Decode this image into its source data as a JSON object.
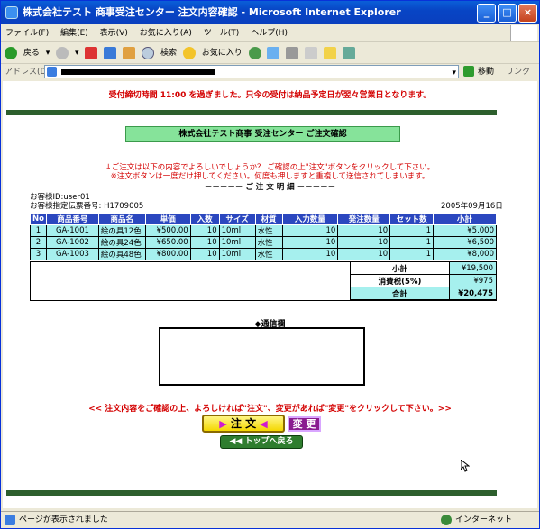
{
  "window": {
    "title": "株式会社テスト 商事受注センター  注文内容確認 - Microsoft Internet Explorer",
    "min": "_",
    "max": "□",
    "close": "×"
  },
  "menu": [
    "ファイル(F)",
    "編集(E)",
    "表示(V)",
    "お気に入り(A)",
    "ツール(T)",
    "ヘルプ(H)"
  ],
  "toolbar": {
    "back": "戻る",
    "search": "検索",
    "favorites": "お気に入り"
  },
  "address": {
    "label": "アドレス(D)",
    "go": "移動",
    "links": "リンク"
  },
  "page": {
    "notice": "受付締切時間 11:00 を過ぎました。只今の受付は納品予定日が翌々営業日となります。",
    "header_title": "株式会社テスト商事 受注センター  ご注文確認",
    "confirm_line1": "↓ご注文は以下の内容でよろしいでしょうか？  ご確認の上\"注文\"ボタンをクリックして下さい。",
    "confirm_line2": "※注文ボタンは一度だけ押してください。何度も押しますと重複して送信されてしまいます。",
    "meisai": "－－－－－ ご 注 文 明 細 －－－－－",
    "customer_id": "お客様ID:user01",
    "slip_no": "お客様指定伝票番号: H1709005",
    "date": "2005年09月16日",
    "columns": [
      "No",
      "商品番号",
      "商品名",
      "単価",
      "入数",
      "サイズ",
      "材質",
      "入力数量",
      "発注数量",
      "セット数",
      "小計"
    ],
    "rows": [
      {
        "no": "1",
        "code": "GA-1001",
        "name": "絵の具12色",
        "price": "¥500.00",
        "qty_in": "10",
        "size": "10ml",
        "material": "水性",
        "input_qty": "10",
        "order_qty": "10",
        "sets": "1",
        "subtotal": "¥5,000"
      },
      {
        "no": "2",
        "code": "GA-1002",
        "name": "絵の具24色",
        "price": "¥650.00",
        "qty_in": "10",
        "size": "10ml",
        "material": "水性",
        "input_qty": "10",
        "order_qty": "10",
        "sets": "1",
        "subtotal": "¥6,500"
      },
      {
        "no": "3",
        "code": "GA-1003",
        "name": "絵の具48色",
        "price": "¥800.00",
        "qty_in": "10",
        "size": "10ml",
        "material": "水性",
        "input_qty": "10",
        "order_qty": "10",
        "sets": "1",
        "subtotal": "¥8,000"
      }
    ],
    "summary": {
      "subtotal_label": "小計",
      "subtotal": "¥19,500",
      "tax_label": "消費税(5%)",
      "tax": "¥975",
      "total_label": "合計",
      "total": "¥20,475"
    },
    "comm_label": "◆通信欄",
    "bottom_msg": "<< 注文内容をご確認の上、よろしければ\"注文\"、変更があれば\"変更\"をクリックして下さい。>>",
    "order_btn": "注 文",
    "change_btn": "変 更",
    "top_btn": "トップへ戻る"
  },
  "status": {
    "text": "ページが表示されました",
    "zone": "インターネット"
  }
}
